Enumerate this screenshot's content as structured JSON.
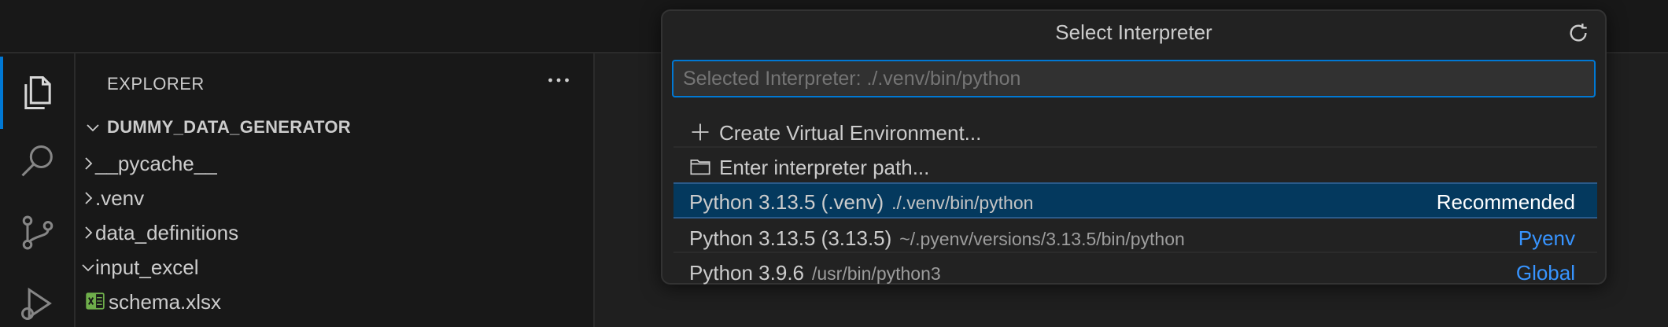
{
  "sidebar": {
    "title": "EXPLORER",
    "root": "DUMMY_DATA_GENERATOR",
    "items": [
      {
        "label": "__pycache__"
      },
      {
        "label": ".venv"
      },
      {
        "label": "data_definitions"
      },
      {
        "label": "input_excel"
      },
      {
        "label": "schema.xlsx"
      }
    ]
  },
  "quickpick": {
    "title": "Select Interpreter",
    "placeholder": "Selected Interpreter: ./.venv/bin/python",
    "actions": [
      {
        "label": "Create Virtual Environment...",
        "icon": "plus-icon"
      },
      {
        "label": "Enter interpreter path...",
        "icon": "folder-icon"
      }
    ],
    "interpreters": [
      {
        "name": "Python 3.13.5 (.venv)",
        "path": "./.venv/bin/python",
        "tag": "Recommended"
      },
      {
        "name": "Python 3.13.5 (3.13.5)",
        "path": "~/.pyenv/versions/3.13.5/bin/python",
        "tag": "Pyenv"
      },
      {
        "name": "Python 3.9.6",
        "path": "/usr/bin/python3",
        "tag": "Global"
      }
    ]
  },
  "colors": {
    "accent": "#0078d4",
    "selection": "#04395e",
    "link": "#3794ff",
    "excel": "#6fae4b"
  }
}
